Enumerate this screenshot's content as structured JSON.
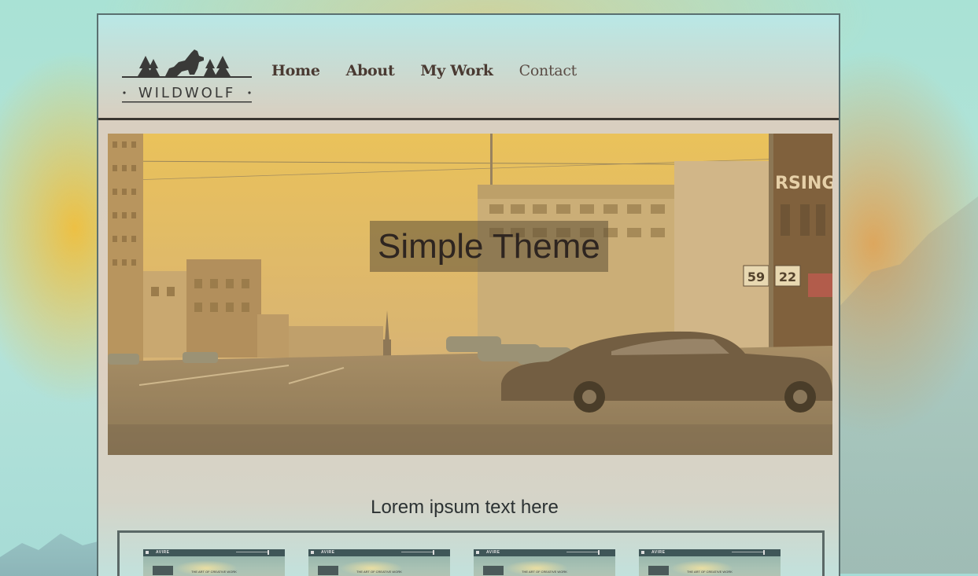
{
  "site": {
    "logo_text": "WILDWOLF"
  },
  "nav": {
    "items": [
      {
        "label": "Home"
      },
      {
        "label": "About"
      },
      {
        "label": "My Work"
      },
      {
        "label": "Contact"
      }
    ]
  },
  "hero": {
    "title": "Simple Theme",
    "signs": {
      "store": "RSING'S",
      "route_a": "59",
      "route_b": "22"
    }
  },
  "section": {
    "title": "Lorem ipsum text here"
  },
  "gallery": {
    "thumbs": [
      {
        "brand": "AVIRE",
        "subtitle": "THE ART OF CREATIVE WORK"
      },
      {
        "brand": "AVIRE",
        "subtitle": "THE ART OF CREATIVE WORK"
      },
      {
        "brand": "AVIRE",
        "subtitle": "THE ART OF CREATIVE WORK"
      },
      {
        "brand": "AVIRE",
        "subtitle": "THE ART OF CREATIVE WORK"
      }
    ]
  },
  "colors": {
    "nav_text": "#4a3a32",
    "page_bg": "#ddd0c0",
    "hero_tint": "#e8c060"
  }
}
